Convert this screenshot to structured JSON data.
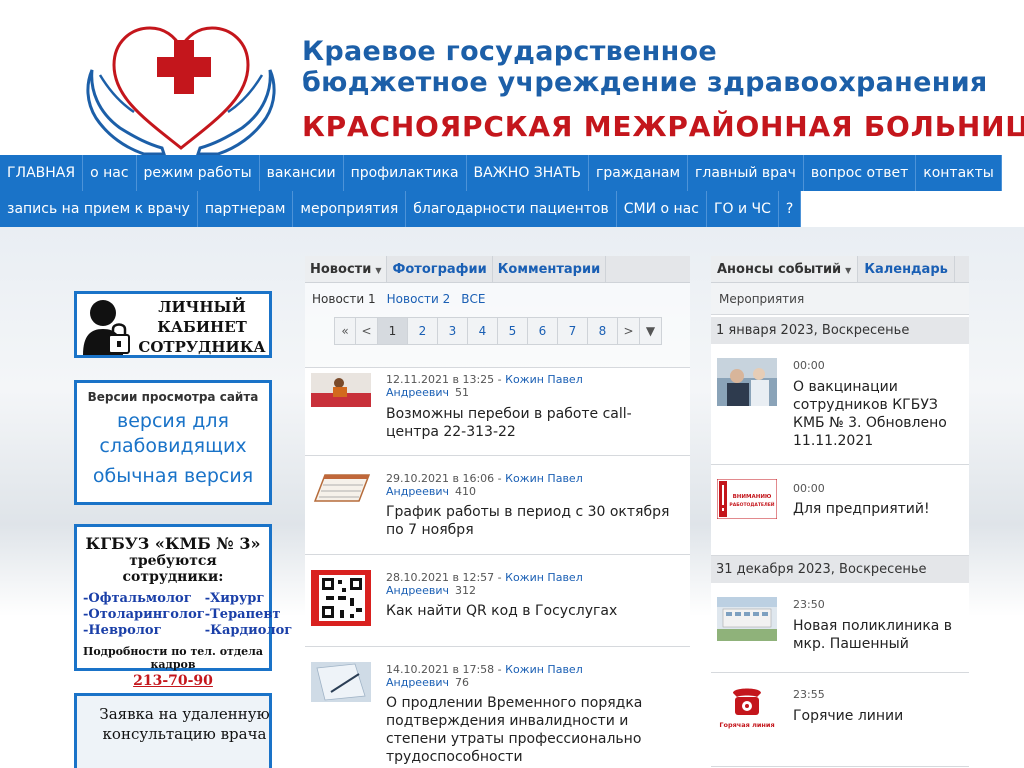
{
  "header": {
    "title_line1": "Краевое государственное",
    "title_line2": "бюджетное учреждение здравоохранения",
    "title_line3": "КРАСНОЯРСКАЯ МЕЖРАЙОННАЯ БОЛЬНИЦ"
  },
  "nav": {
    "row1": [
      "ГЛАВНАЯ",
      "о нас",
      "режим работы",
      "вакансии",
      "профилактика",
      "ВАЖНО ЗНАТЬ",
      "гражданам",
      "главный врач",
      "вопрос ответ",
      "контакты"
    ],
    "row2": [
      "запись на прием к врачу",
      "партнерам",
      "мероприятия",
      "благодарности пациентов",
      "СМИ о нас",
      "ГО и ЧС",
      "?"
    ]
  },
  "banners": {
    "cabinet": {
      "line1": "ЛИЧНЫЙ",
      "line2": "КАБИНЕТ",
      "line3": "СОТРУДНИКА"
    },
    "versions": {
      "caption": "Версии просмотра сайта",
      "impaired_line1": "версия для",
      "impaired_line2": "слабовидящих",
      "normal": "обычная версия"
    },
    "jobs": {
      "title": "КГБУЗ «КМБ № 3»",
      "subtitle": "требуются сотрудники:",
      "left": [
        "-Офтальмолог",
        "-Отоларинголог",
        "-Невролог"
      ],
      "right": [
        "-Хирург",
        "-Терапевт",
        "-Кардиолог"
      ],
      "details": "Подробности по тел. отдела кадров",
      "phone": "213-70-90"
    },
    "consult": {
      "line1": "Заявка на удаленную",
      "line2": "консультацию врача"
    }
  },
  "news": {
    "tabs": [
      {
        "label": "Новости",
        "active": true
      },
      {
        "label": "Фотографии",
        "active": false
      },
      {
        "label": "Комментарии",
        "active": false
      }
    ],
    "subtabs": [
      "Новости 1",
      "Новости 2",
      "ВСЕ"
    ],
    "pager": [
      "«",
      "<",
      "1",
      "2",
      "3",
      "4",
      "5",
      "6",
      "7",
      "8",
      ">",
      "▼"
    ],
    "items": [
      {
        "date": "12.11.2021 в 13:25",
        "author1": "Кожин Павел",
        "author2": "Андреевич",
        "count": "51",
        "title": "Возможны перебои в работе call-центра 22-313-22"
      },
      {
        "date": "29.10.2021 в 16:06",
        "author1": "Кожин Павел",
        "author2": "Андреевич",
        "count": "410",
        "title": "График работы в период с 30 октября по 7 ноября"
      },
      {
        "date": "28.10.2021 в 12:57",
        "author1": "Кожин Павел",
        "author2": "Андреевич",
        "count": "312",
        "title": "Как найти QR код в Госуслугах"
      },
      {
        "date": "14.10.2021 в 17:58",
        "author1": "Кожин Павел",
        "author2": "Андреевич",
        "count": "76",
        "title": "О продлении Временного порядка подтверждения инвалидности и степени утраты профессионально трудоспособности"
      }
    ]
  },
  "events": {
    "tabs": [
      {
        "label": "Анонсы событий",
        "active": true
      },
      {
        "label": "Календарь",
        "active": false
      }
    ],
    "sub": "Мероприятия",
    "date1": "1 января 2023, Воскресенье",
    "date2": "31 декабря 2023, Воскресенье",
    "items": [
      {
        "time": "00:00",
        "title": "О вакцинации сотрудников КГБУЗ КМБ № 3. Обновлено 11.11.2021"
      },
      {
        "time": "00:00",
        "title": "Для предприятий!",
        "thumb_text": "ВНИМАНИЮ РАБОТОДАТЕЛЕЙ"
      },
      {
        "time": "23:50",
        "title": "Новая поликлиника в мкр. Пашенный"
      },
      {
        "time": "23:55",
        "title": "Горячие линии",
        "thumb_text": "Горячая линия"
      }
    ]
  },
  "colors": {
    "brand_blue": "#1a73c8",
    "title_blue": "#1c5fa8",
    "title_red": "#c4161c"
  }
}
